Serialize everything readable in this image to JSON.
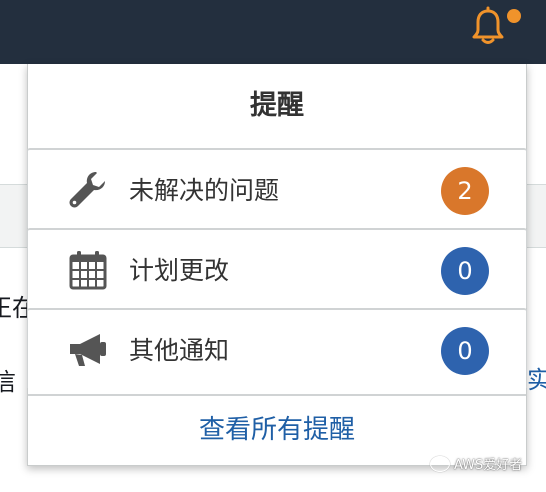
{
  "header": {
    "bell_icon": "bell-icon",
    "bell_color": "#f0932b",
    "dot_color": "#f0932b"
  },
  "background": {
    "left_text_1": "正在",
    "left_text_2": "信",
    "right_text": "实"
  },
  "panel": {
    "title": "提醒",
    "items": [
      {
        "icon": "wrench-icon",
        "label": "未解决的问题",
        "count": "2",
        "color": "#d9772b"
      },
      {
        "icon": "calendar-icon",
        "label": "计划更改",
        "count": "0",
        "color": "#2e63ae"
      },
      {
        "icon": "megaphone-icon",
        "label": "其他通知",
        "count": "0",
        "color": "#2e63ae"
      }
    ],
    "view_all": "查看所有提醒"
  },
  "watermark": {
    "text": "AWS爱好者"
  }
}
